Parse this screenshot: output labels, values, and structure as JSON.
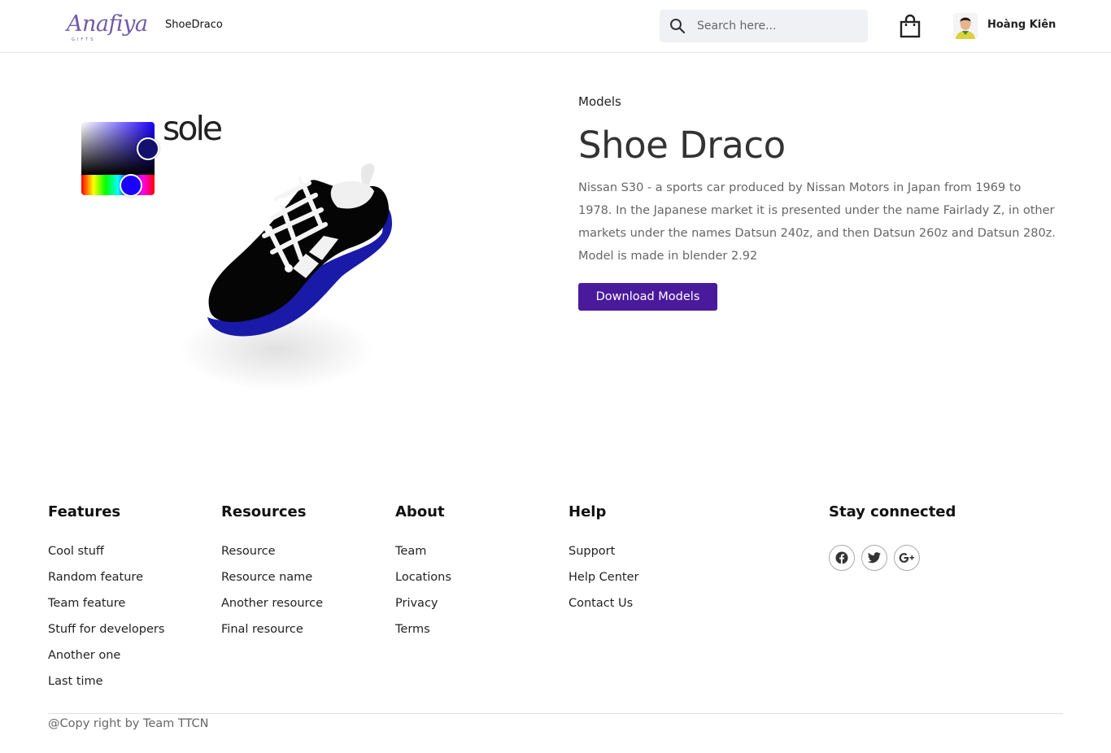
{
  "header": {
    "logo_text": "Anafiya",
    "logo_sub": "GIFTS",
    "brand_link": "ShoeDraco",
    "search_placeholder": "Search here...",
    "user_name": "Hoàng Kiên"
  },
  "viewer": {
    "part_label": "sole",
    "selected_color": "#14106e",
    "hue_color": "#1a00ff"
  },
  "product": {
    "breadcrumb": "Models",
    "title": "Shoe Draco",
    "description": "Nissan S30 - a sports car produced by Nissan Motors in Japan from 1969 to 1978. In the Japanese market it is presented under the name Fairlady Z, in other markets under the names Datsun 240z, and then Datsun 260z and Datsun 280z. Model is made in blender 2.92",
    "download_label": "Download Models",
    "accent_color": "#4a1a9c"
  },
  "footer": {
    "columns": [
      {
        "heading": "Features",
        "links": [
          "Cool stuff",
          "Random feature",
          "Team feature",
          "Stuff for developers",
          "Another one",
          "Last time"
        ]
      },
      {
        "heading": "Resources",
        "links": [
          "Resource",
          "Resource name",
          "Another resource",
          "Final resource"
        ]
      },
      {
        "heading": "About",
        "links": [
          "Team",
          "Locations",
          "Privacy",
          "Terms"
        ]
      },
      {
        "heading": "Help",
        "links": [
          "Support",
          "Help Center",
          "Contact Us"
        ]
      }
    ],
    "social_heading": "Stay connected",
    "social_icons": [
      "facebook-icon",
      "twitter-icon",
      "google-plus-icon"
    ],
    "copyright": "@Copy right by Team TTCN"
  }
}
